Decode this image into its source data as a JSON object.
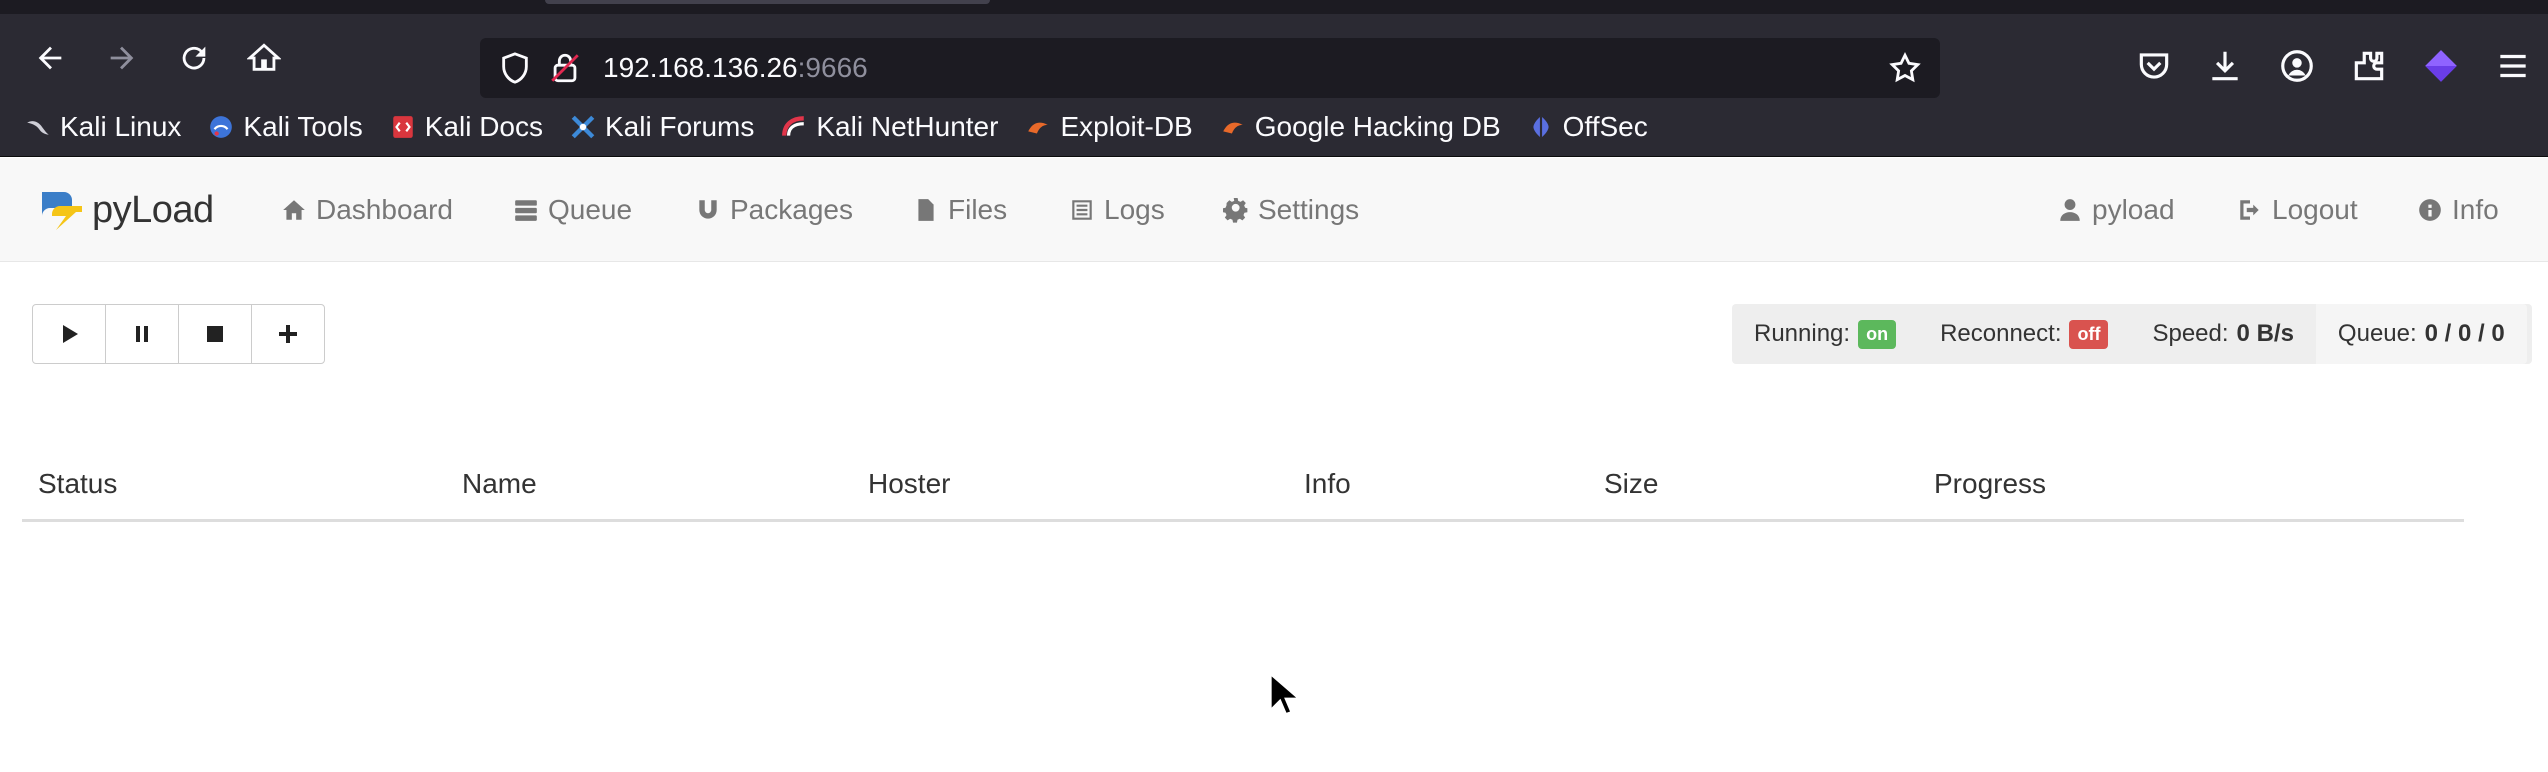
{
  "browser": {
    "url_host": "192.168.136.26",
    "url_port": ":9666",
    "bookmarks": [
      {
        "label": "Kali Linux",
        "icon": "kali-dragon-icon"
      },
      {
        "label": "Kali Tools",
        "icon": "kali-tools-icon"
      },
      {
        "label": "Kali Docs",
        "icon": "kali-docs-icon"
      },
      {
        "label": "Kali Forums",
        "icon": "kali-forums-icon"
      },
      {
        "label": "Kali NetHunter",
        "icon": "kali-nethunter-icon"
      },
      {
        "label": "Exploit-DB",
        "icon": "exploit-db-icon"
      },
      {
        "label": "Google Hacking DB",
        "icon": "ghdb-icon"
      },
      {
        "label": "OffSec",
        "icon": "offsec-icon"
      }
    ]
  },
  "app": {
    "logo_text": "pyLoad",
    "nav": {
      "dashboard": "Dashboard",
      "queue": "Queue",
      "packages": "Packages",
      "files": "Files",
      "logs": "Logs",
      "settings": "Settings",
      "user": "pyload",
      "logout": "Logout",
      "info": "Info"
    },
    "status": {
      "running_label": "Running:",
      "running_value": "on",
      "reconnect_label": "Reconnect:",
      "reconnect_value": "off",
      "speed_label": "Speed:",
      "speed_value": "0 B/s",
      "queue_label": "Queue:",
      "queue_value": "0 / 0 / 0"
    },
    "table": {
      "columns": [
        "Status",
        "Name",
        "Hoster",
        "Info",
        "Size",
        "Progress"
      ]
    }
  },
  "colors": {
    "on": "#5cb85c",
    "off": "#d9534f",
    "chrome_bg": "#2b2a33"
  }
}
